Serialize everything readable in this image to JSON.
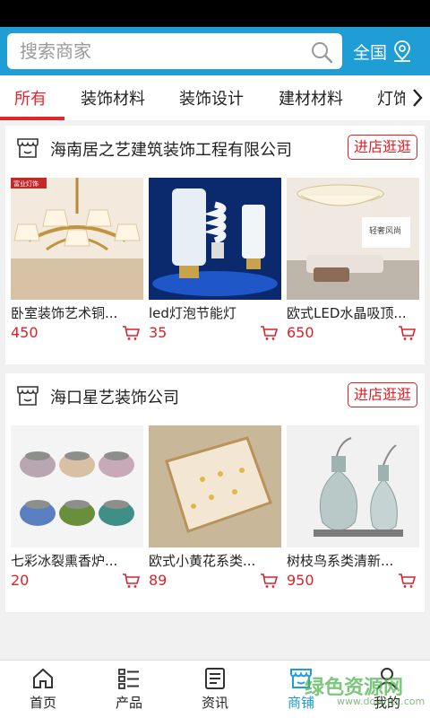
{
  "search": {
    "placeholder": "搜索商家",
    "region_label": "全国"
  },
  "tabs": [
    {
      "label": "所有",
      "active": true
    },
    {
      "label": "装饰材料"
    },
    {
      "label": "装饰设计"
    },
    {
      "label": "建材材料"
    },
    {
      "label": "灯饰"
    }
  ],
  "shops": [
    {
      "name": "海南居之艺建筑装饰工程有限公司",
      "visit_label": "进店逛逛",
      "products": [
        {
          "title": "卧室装饰艺术铜...",
          "price": "450",
          "badge": "富业灯饰"
        },
        {
          "title": "led灯泡节能灯",
          "price": "35"
        },
        {
          "title": "欧式LED水晶吸顶...",
          "price": "650",
          "badge": "轻奢风尚"
        }
      ]
    },
    {
      "name": "海口星艺装饰公司",
      "visit_label": "进店逛逛",
      "products": [
        {
          "title": "七彩冰裂熏香炉...",
          "price": "20"
        },
        {
          "title": "欧式小黄花系类...",
          "price": "89"
        },
        {
          "title": "树枝鸟系类清新...",
          "price": "950"
        }
      ]
    }
  ],
  "bottom_nav": [
    {
      "label": "首页",
      "icon": "home-icon"
    },
    {
      "label": "产品",
      "icon": "list-icon"
    },
    {
      "label": "资讯",
      "icon": "news-icon"
    },
    {
      "label": "商铺",
      "icon": "store-icon",
      "active": true
    },
    {
      "label": "我的",
      "icon": "user-icon"
    }
  ],
  "watermark": {
    "text": "绿色资源网",
    "sub": "www.downcc.com"
  },
  "colors": {
    "header_blue": "#1f9ed6",
    "accent_red": "#d8232a",
    "active_tab": "#e0262e"
  }
}
